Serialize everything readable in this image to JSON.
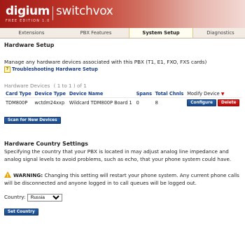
{
  "header": {
    "logo_brand": "digium",
    "logo_product": "switchvox",
    "edition": "FREE EDITION 1.0"
  },
  "tabs": [
    {
      "label": "Extensions",
      "active": false
    },
    {
      "label": "PBX Features",
      "active": false
    },
    {
      "label": "System Setup",
      "active": true
    },
    {
      "label": "Diagnostics",
      "active": false
    }
  ],
  "hardware_setup": {
    "title": "Hardware Setup",
    "description": "Manage any hardware devices associated with this PBX (T1, E1, FXO, FXS cards)",
    "troubleshoot_link": "Troubleshooting Hardware Setup"
  },
  "devices": {
    "section_label": "Hardware Devices",
    "range": "( 1 to 1 ) of 1",
    "columns": [
      "Card Type",
      "Device Type",
      "Device Name",
      "Spans",
      "Total Chnls",
      "Modify Device"
    ],
    "rows": [
      {
        "card_type": "TDM800P",
        "device_type": "wctdm24xxp",
        "device_name": "Wildcard TDM800P Board 1",
        "spans": "0",
        "total_chnls": "8"
      }
    ],
    "configure_label": "Configure",
    "delete_label": "Delete",
    "scan_label": "Scan for New Devices"
  },
  "country": {
    "title": "Hardware Country Settings",
    "description": "Specifying the country that your PBX is located in may adjust analog line impedance and analog signal levels to avoid problems, such as echo, that your phone system could have.",
    "warning_label": "WARNING:",
    "warning_text": "Changing this setting will restart your phone system. Any current phone calls will be disconnected and anyone logged in to call queues will be logged out.",
    "country_label": "Country:",
    "selected": "Russia",
    "set_label": "Set Country"
  },
  "colors": {
    "header_red": "#a11a16",
    "link_blue": "#1a3f8a",
    "button_blue": "#1a4888",
    "button_red": "#b80c0c",
    "warning_orange": "#e6a400"
  }
}
